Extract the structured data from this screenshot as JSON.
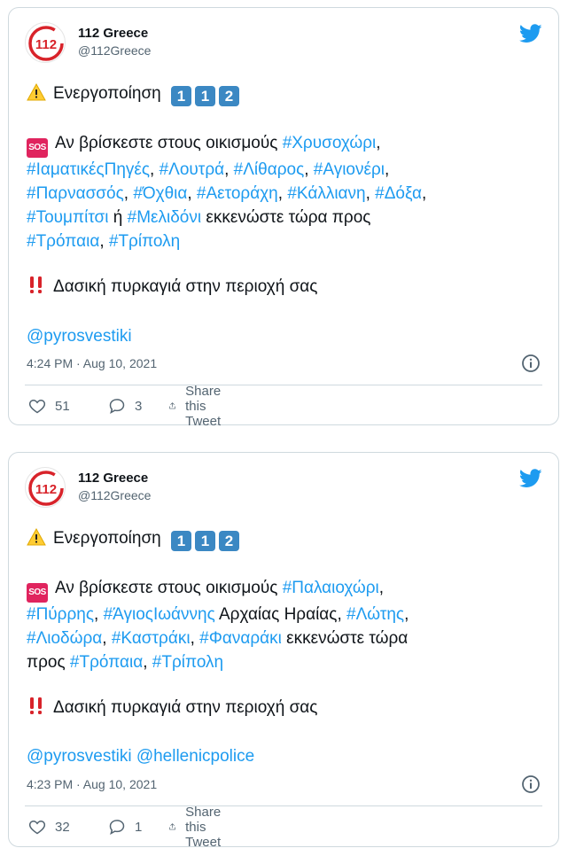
{
  "tweets": [
    {
      "author": "112 Greece",
      "handle": "@112Greece",
      "activation": "Ενεργοποίηση",
      "activation_digits": [
        "1",
        "1",
        "2"
      ],
      "alert_lines": [
        [
          {
            "t": "Αν βρίσκεστε στους οικισμούς ",
            "tag": false
          },
          {
            "t": "#Χρυσοχώρι",
            "tag": true
          },
          {
            "t": ",",
            "tag": false
          }
        ],
        [
          {
            "t": "#ΙαματικέςΠηγές",
            "tag": true
          },
          {
            "t": ", ",
            "tag": false
          },
          {
            "t": "#Λουτρά",
            "tag": true
          },
          {
            "t": ", ",
            "tag": false
          },
          {
            "t": "#Λίθαρος",
            "tag": true
          },
          {
            "t": ", ",
            "tag": false
          },
          {
            "t": "#Αγιονέρι",
            "tag": true
          },
          {
            "t": ",",
            "tag": false
          }
        ],
        [
          {
            "t": "#Παρνασσός",
            "tag": true
          },
          {
            "t": ", ",
            "tag": false
          },
          {
            "t": "#Όχθια",
            "tag": true
          },
          {
            "t": ", ",
            "tag": false
          },
          {
            "t": "#Αετοράχη",
            "tag": true
          },
          {
            "t": ", ",
            "tag": false
          },
          {
            "t": "#Κάλλιανη",
            "tag": true
          },
          {
            "t": ", ",
            "tag": false
          },
          {
            "t": "#Δόξα",
            "tag": true
          },
          {
            "t": ",",
            "tag": false
          }
        ],
        [
          {
            "t": "#Τουμπίτσι",
            "tag": true
          },
          {
            "t": " ή ",
            "tag": false
          },
          {
            "t": "#Μελιδόνι",
            "tag": true
          },
          {
            "t": " εκκενώστε τώρα προς",
            "tag": false
          }
        ],
        [
          {
            "t": "#Τρόπαια",
            "tag": true
          },
          {
            "t": ", ",
            "tag": false
          },
          {
            "t": "#Τρίπολη",
            "tag": true
          }
        ]
      ],
      "fire_text": "Δασική πυρκαγιά στην περιοχή σας",
      "mentions": "@pyrosvestiki",
      "timestamp": "4:24 PM · Aug 10, 2021",
      "likes": "51",
      "replies": "3",
      "share_label": "Share this Tweet"
    },
    {
      "author": "112 Greece",
      "handle": "@112Greece",
      "activation": "Ενεργοποίηση",
      "activation_digits": [
        "1",
        "1",
        "2"
      ],
      "alert_lines": [
        [
          {
            "t": "Αν βρίσκεστε στους οικισμούς ",
            "tag": false
          },
          {
            "t": "#Παλαιοχώρι",
            "tag": true
          },
          {
            "t": ",",
            "tag": false
          }
        ],
        [
          {
            "t": "#Πύρρης",
            "tag": true
          },
          {
            "t": ", ",
            "tag": false
          },
          {
            "t": "#ΆγιοςΙωάννης",
            "tag": true
          },
          {
            "t": " Αρχαίας Ηραίας, ",
            "tag": false
          },
          {
            "t": "#Λώτης",
            "tag": true
          },
          {
            "t": ",",
            "tag": false
          }
        ],
        [
          {
            "t": "#Λιοδώρα",
            "tag": true
          },
          {
            "t": ", ",
            "tag": false
          },
          {
            "t": "#Καστράκι",
            "tag": true
          },
          {
            "t": ", ",
            "tag": false
          },
          {
            "t": "#Φαναράκι",
            "tag": true
          },
          {
            "t": " εκκενώστε τώρα",
            "tag": false
          }
        ],
        [
          {
            "t": "προς ",
            "tag": false
          },
          {
            "t": "#Τρόπαια",
            "tag": true
          },
          {
            "t": ", ",
            "tag": false
          },
          {
            "t": "#Τρίπολη",
            "tag": true
          }
        ]
      ],
      "fire_text": "Δασική πυρκαγιά στην περιοχή σας",
      "mentions": "@pyrosvestiki @hellenicpolice",
      "timestamp": "4:23 PM · Aug 10, 2021",
      "likes": "32",
      "replies": "1",
      "share_label": "Share this Tweet"
    }
  ],
  "icons": {
    "avatar": "112-logo-icon",
    "brand": "twitter-bird-icon",
    "warning": "warning-icon",
    "sos": "sos-icon",
    "double_exclamation": "double-exclamation-icon",
    "info": "info-icon",
    "like": "heart-icon",
    "reply": "reply-icon",
    "share": "share-icon"
  },
  "colors": {
    "link": "#1d9bf0",
    "text": "#0f1419",
    "muted": "#536471",
    "border": "#cfd9de",
    "brand_red": "#d8232a"
  }
}
